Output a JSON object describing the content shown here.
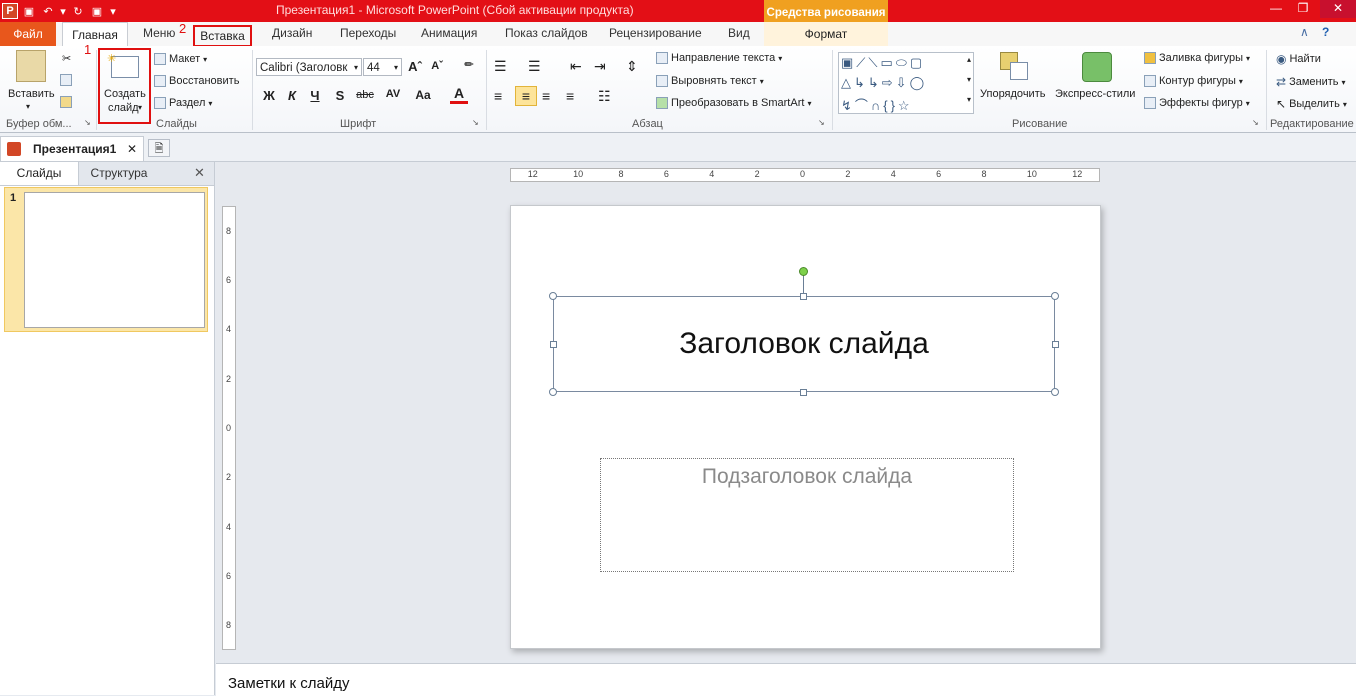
{
  "titlebar": {
    "title": "Презентация1 - Microsoft PowerPoint (Сбой активации продукта)",
    "context_tab": "Средства рисования",
    "app_icon": "P"
  },
  "tabs": {
    "file": "Файл",
    "home": "Главная",
    "menu": "Меню",
    "insert": "Вставка",
    "design": "Дизайн",
    "transitions": "Переходы",
    "animation": "Анимация",
    "slideshow": "Показ слайдов",
    "review": "Рецензирование",
    "view": "Вид",
    "format": "Формат"
  },
  "markers": {
    "one": "1",
    "two": "2"
  },
  "ribbon": {
    "clipboard": {
      "paste": "Вставить",
      "label": "Буфер обм..."
    },
    "slides": {
      "new_slide_line1": "Создать",
      "new_slide_line2": "слайд",
      "layout": "Макет",
      "reset": "Восстановить",
      "section": "Раздел",
      "label": "Слайды"
    },
    "font": {
      "font_name": "Calibri (Заголовк",
      "font_size": "44",
      "bold": "Ж",
      "italic": "К",
      "underline": "Ч",
      "shadow": "S",
      "strike": "abc",
      "spacing": "AV",
      "case": "Aa",
      "color": "A",
      "label": "Шрифт"
    },
    "paragraph": {
      "text_direction": "Направление текста",
      "align_text": "Выровнять текст",
      "smartart": "Преобразовать в SmartArt",
      "label": "Абзац"
    },
    "drawing": {
      "arrange": "Упорядочить",
      "quick_styles": "Экспресс-стили",
      "fill": "Заливка фигуры",
      "outline": "Контур фигуры",
      "effects": "Эффекты фигур",
      "label": "Рисование"
    },
    "editing": {
      "find": "Найти",
      "replace": "Заменить",
      "select": "Выделить",
      "label": "Редактирование"
    }
  },
  "doc": {
    "tab": "Презентация1"
  },
  "leftpane": {
    "tab_slides": "Слайды",
    "tab_outline": "Структура",
    "slide_number": "1"
  },
  "slide": {
    "title": "Заголовок слайда",
    "subtitle": "Подзаголовок слайда"
  },
  "hruler_labels": [
    "12",
    "10",
    "8",
    "6",
    "4",
    "2",
    "0",
    "2",
    "4",
    "6",
    "8",
    "10",
    "12"
  ],
  "vruler_labels": [
    "8",
    "6",
    "4",
    "2",
    "0",
    "2",
    "4",
    "6",
    "8"
  ],
  "notes": {
    "placeholder": "Заметки к слайду"
  },
  "colors": {
    "titlebar": "#e30f16",
    "file_tab": "#e8571c",
    "highlight": "#e01010",
    "context": "#f0a020"
  }
}
